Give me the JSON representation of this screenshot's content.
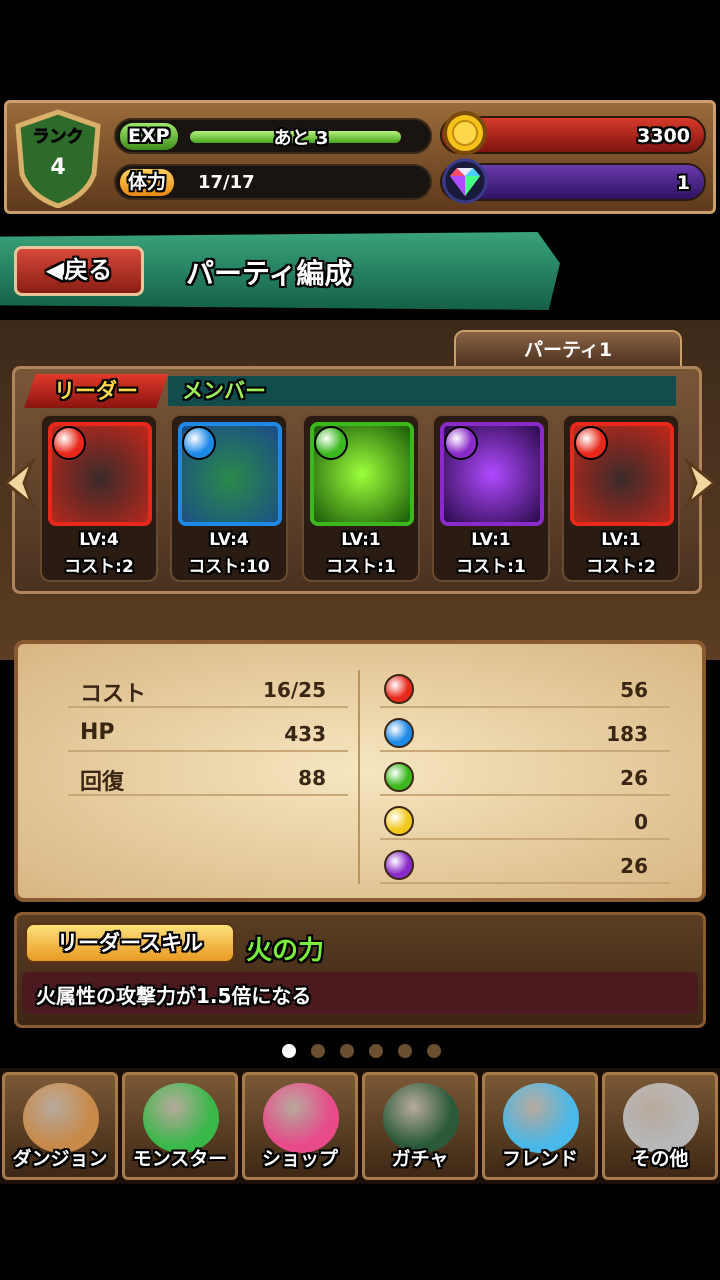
{
  "status": {
    "rank_label": "ランク",
    "rank_value": "4",
    "exp_label": "EXP",
    "exp_text": "あと 3",
    "exp_progress": 0.95,
    "stamina_label": "体力",
    "stamina_value": "17/17",
    "coins": "3300",
    "magic_stones": "1"
  },
  "header": {
    "back_label": "戻る",
    "title": "パーティ編成"
  },
  "party": {
    "tab_label": "パーティ1",
    "leader_label": "リーダー",
    "member_label": "メンバー",
    "slots": [
      {
        "lv": "LV:4",
        "cost": "コスト:2",
        "attribute": "fire"
      },
      {
        "lv": "LV:4",
        "cost": "コスト:10",
        "attribute": "water"
      },
      {
        "lv": "LV:1",
        "cost": "コスト:1",
        "attribute": "wood"
      },
      {
        "lv": "LV:1",
        "cost": "コスト:1",
        "attribute": "dark"
      },
      {
        "lv": "LV:1",
        "cost": "コスト:2",
        "attribute": "fire"
      }
    ]
  },
  "stats": {
    "left": [
      {
        "label": "コスト",
        "value": "16/25"
      },
      {
        "label": "HP",
        "value": "433"
      },
      {
        "label": "回復",
        "value": "88"
      }
    ],
    "attributes": [
      {
        "attribute": "fire",
        "value": "56"
      },
      {
        "attribute": "water",
        "value": "183"
      },
      {
        "attribute": "wood",
        "value": "26"
      },
      {
        "attribute": "light",
        "value": "0"
      },
      {
        "attribute": "dark",
        "value": "26"
      }
    ]
  },
  "leader_skill": {
    "badge": "リーダースキル",
    "name": "火の力",
    "description": "火属性の攻撃力が1.5倍になる"
  },
  "pagination": {
    "total": 6,
    "current": 1
  },
  "nav": [
    {
      "label": "ダンジョン",
      "icon": "dungeon-icon"
    },
    {
      "label": "モンスター",
      "icon": "monster-icon"
    },
    {
      "label": "ショップ",
      "icon": "shop-icon"
    },
    {
      "label": "ガチャ",
      "icon": "gacha-icon"
    },
    {
      "label": "フレンド",
      "icon": "friend-icon"
    },
    {
      "label": "その他",
      "icon": "gear-icon"
    }
  ],
  "colors": {
    "fire": "#e8281a",
    "water": "#1e8ae8",
    "wood": "#3ab81e",
    "light": "#f2c81a",
    "dark": "#8a2ac8"
  }
}
